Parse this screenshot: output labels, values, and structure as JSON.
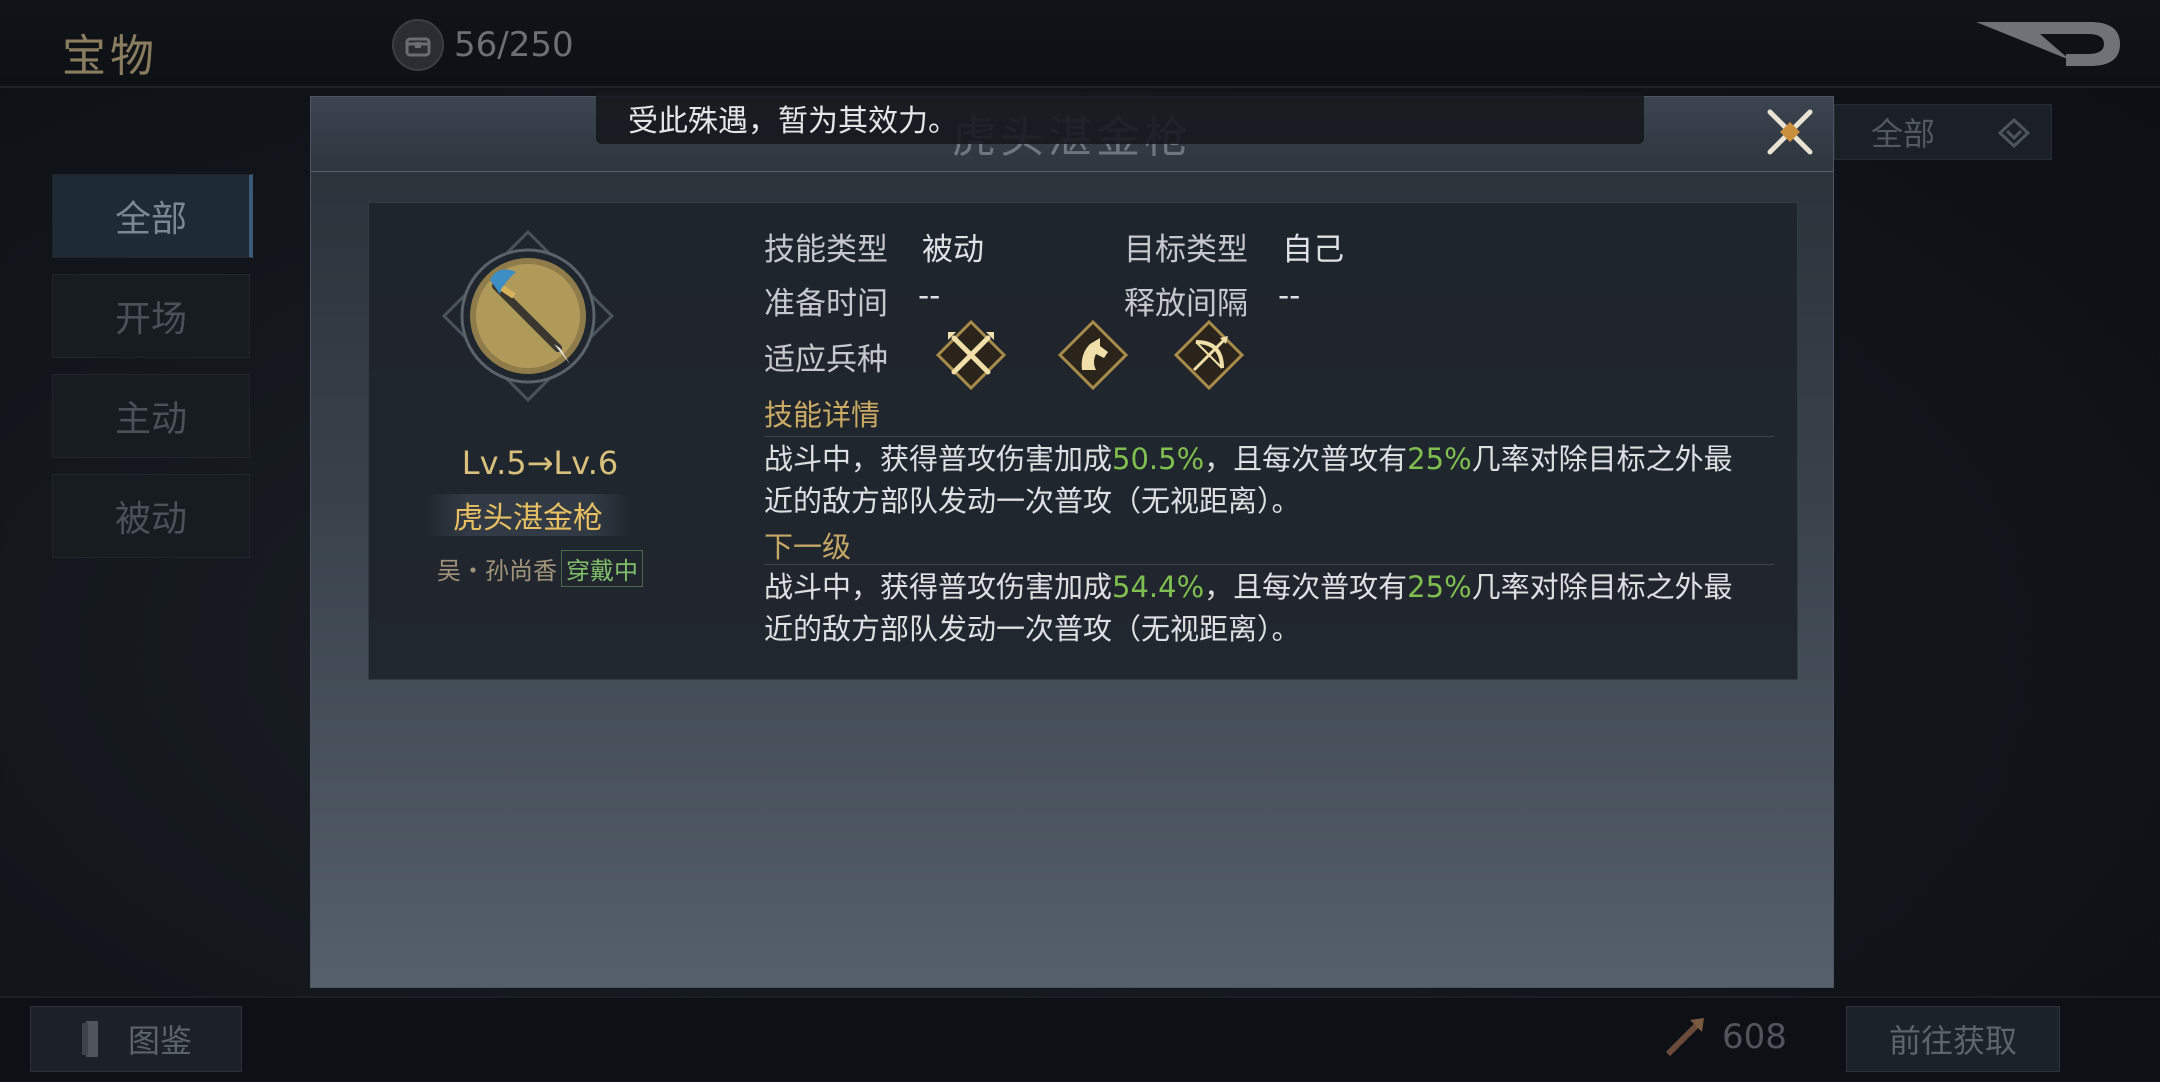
{
  "header": {
    "title": "宝物",
    "count": "56/250"
  },
  "sidebar": {
    "items": [
      {
        "label": "全部",
        "active": true
      },
      {
        "label": "开场",
        "active": false
      },
      {
        "label": "主动",
        "active": false
      },
      {
        "label": "被动",
        "active": false
      }
    ]
  },
  "filter": {
    "label": "全部"
  },
  "footer": {
    "codex_label": "图鉴",
    "resource_count": "608",
    "obtain_label": "前往获取"
  },
  "dialog": {
    "title": "虎头湛金枪",
    "toast": "受此殊遇，暂为其效力。",
    "item": {
      "level": "Lv.5→Lv.6",
      "name": "虎头湛金枪",
      "owner": "吴・孙尚香",
      "owner_status": "穿戴中"
    },
    "attrs": {
      "skill_type_label": "技能类型",
      "skill_type_value": "被动",
      "target_type_label": "目标类型",
      "target_type_value": "自己",
      "prep_time_label": "准备时间",
      "prep_time_value": "--",
      "interval_label": "释放间隔",
      "interval_value": "--",
      "troops_label": "适应兵种",
      "troop_icons": [
        "spearman-icon",
        "cavalry-icon",
        "archer-icon"
      ]
    },
    "details": {
      "heading": "技能详情",
      "current": {
        "p1": "战斗中，获得普攻伤害加成",
        "v1": "50.5%",
        "p2": "，且每次普攻有",
        "v2": "25%",
        "p3": "几率对除目标之外最",
        "line2": "近的敌方部队发动一次普攻（无视距离）。"
      },
      "next_heading": "下一级",
      "next": {
        "p1": "战斗中，获得普攻伤害加成",
        "v1": "54.4%",
        "p2": "，且每次普攻有",
        "v2": "25%",
        "p3": "几率对除目标之外最",
        "line2": "近的敌方部队发动一次普攻（无视距离）。"
      }
    }
  },
  "colors": {
    "highlight": "#7fbf4f",
    "gold": "#e8c062",
    "section": "#cbaa63"
  }
}
